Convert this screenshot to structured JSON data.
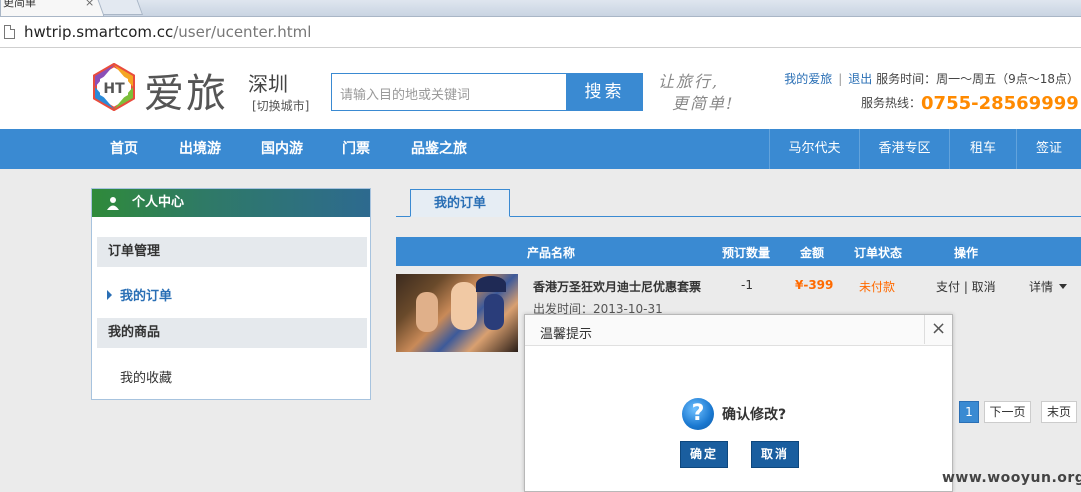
{
  "browser": {
    "tab_title": "更简单",
    "tab_close": "×",
    "url_host": "hwtrip.smartcom.cc",
    "url_path": "/user/ucenter.html"
  },
  "header": {
    "logo_mark": "HT",
    "logo_text": "爱旅",
    "city": "深圳",
    "switch_city": "[切换城市]",
    "search_placeholder": "请输入目的地或关键词",
    "search_button": "搜索",
    "slogan_line1": "让旅行,",
    "slogan_line2": "更简单!",
    "my_aili": "我的爱旅",
    "logout": "退出",
    "service_time": "服务时间：周一～周五（9点～18点）",
    "hotline_label": "服务热线：",
    "hotline_number": "0755-28569999"
  },
  "nav": {
    "left": [
      "首页",
      "出境游",
      "国内游",
      "门票",
      "品鉴之旅"
    ],
    "right": [
      "马尔代夫",
      "香港专区",
      "租车",
      "签证"
    ]
  },
  "sidebar": {
    "title": "个人中心",
    "section1": "订单管理",
    "my_orders": "我的订单",
    "section2": "我的商品",
    "my_favorites": "我的收藏"
  },
  "orders": {
    "tab": "我的订单",
    "columns": [
      "产品名称",
      "预订数量",
      "金额",
      "订单状态",
      "操作"
    ],
    "row": {
      "name": "香港万圣狂欢月迪士尼优惠套票",
      "date": "出发时间：2013-10-31",
      "qty": "-1",
      "amount": "¥-399",
      "status": "未付款",
      "ops": "支付 | 取消",
      "detail": "详情"
    },
    "pager": [
      "1",
      "下一页",
      "末页"
    ]
  },
  "dialog": {
    "title": "温馨提示",
    "close": "×",
    "icon": "?",
    "message": "确认修改?",
    "ok": "确定",
    "cancel": "取消"
  },
  "watermark": "www.wooyun.org",
  "colors": {
    "accent": "#3a8ad2",
    "price": "#ff6a00",
    "hotline": "#ff8a00"
  }
}
